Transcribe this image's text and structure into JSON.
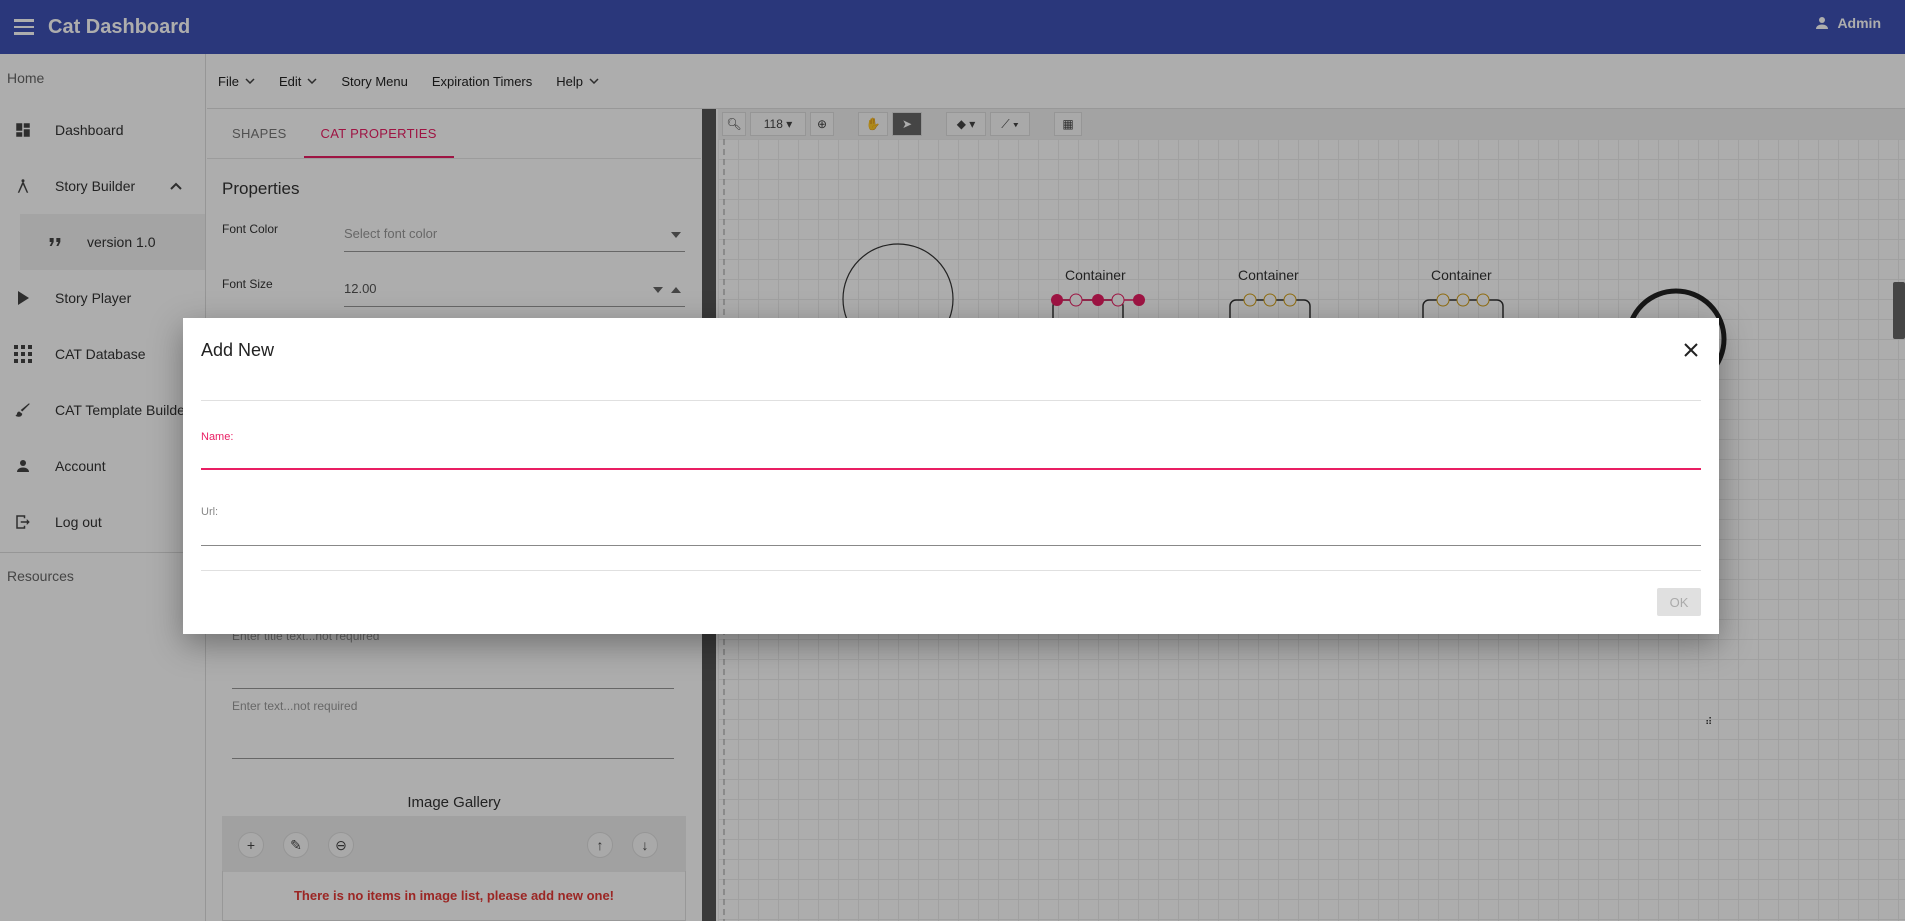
{
  "header": {
    "title": "Cat Dashboard",
    "user": "Admin"
  },
  "sidebar": {
    "home": "Home",
    "items": [
      {
        "label": "Dashboard",
        "icon": "dashboard-icon"
      },
      {
        "label": "Story Builder",
        "icon": "compass-icon"
      },
      {
        "label": "version 1.0",
        "icon": "quote-icon"
      },
      {
        "label": "Story Player",
        "icon": "play-icon"
      },
      {
        "label": "CAT Database",
        "icon": "apps-grid-icon"
      },
      {
        "label": "CAT Template Builder",
        "icon": "brush-icon"
      },
      {
        "label": "Account",
        "icon": "person-icon"
      },
      {
        "label": "Log out",
        "icon": "logout-icon"
      }
    ],
    "resources": "Resources"
  },
  "menubar": {
    "file": "File",
    "edit": "Edit",
    "story_menu": "Story Menu",
    "expiration_timers": "Expiration Timers",
    "help": "Help"
  },
  "panel": {
    "tabs": [
      "SHAPES",
      "CAT PROPERTIES"
    ],
    "properties_title": "Properties",
    "font_color_label": "Font Color",
    "font_color_placeholder": "Select font color",
    "font_size_label": "Font Size",
    "font_size_value": "12.00",
    "title_placeholder": "Enter title text...not required",
    "text_placeholder": "Enter text...not required",
    "gallery_title": "Image Gallery",
    "empty_message": "There is no items in image list, please add new one!"
  },
  "toolbar": {
    "zoom": "118"
  },
  "canvas": {
    "container_label": "Container"
  },
  "dialog": {
    "title": "Add New",
    "name_label": "Name:",
    "name_value": "",
    "url_label": "Url:",
    "url_value": "",
    "ok": "OK"
  },
  "colors": {
    "primary": "#3f51b5",
    "accent": "#e91e63",
    "error": "#e53935"
  }
}
